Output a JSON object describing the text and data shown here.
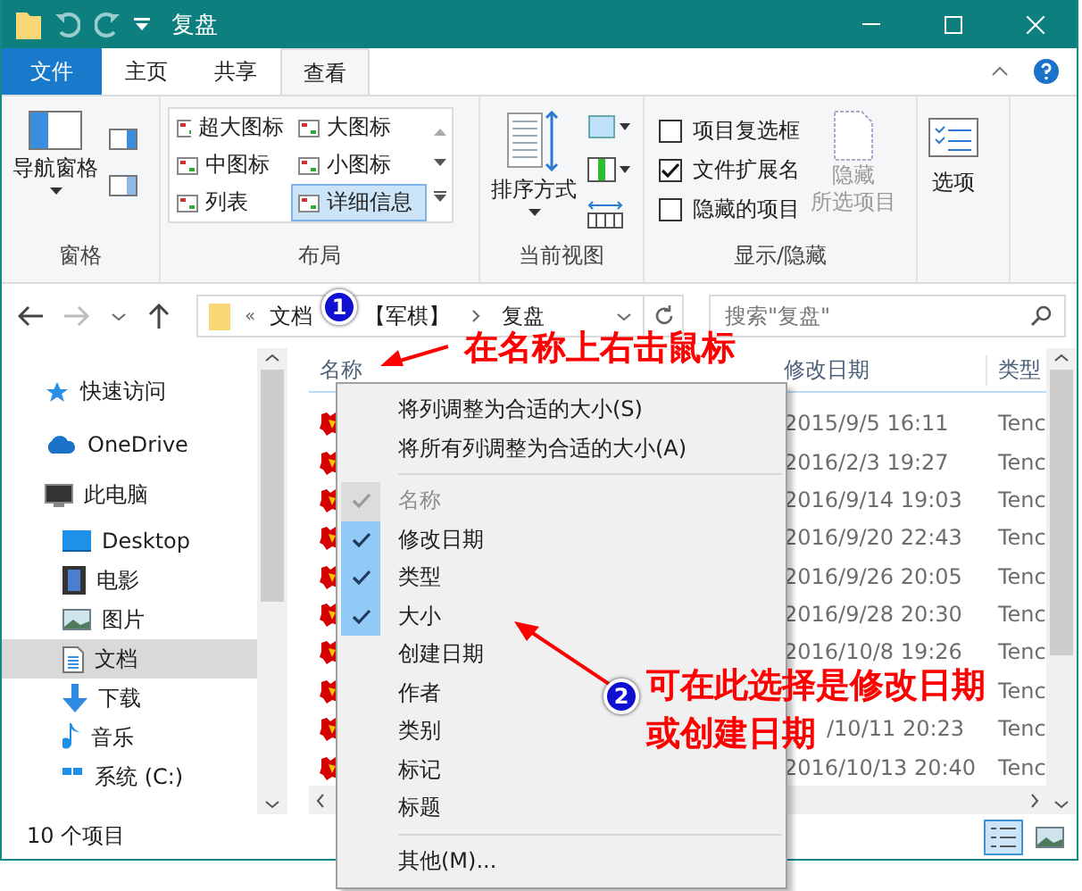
{
  "window": {
    "title": "复盘"
  },
  "ribbon": {
    "tabs": [
      {
        "label": "文件",
        "kind": "file",
        "selected": false
      },
      {
        "label": "主页",
        "kind": "tab",
        "selected": false
      },
      {
        "label": "共享",
        "kind": "tab",
        "selected": false
      },
      {
        "label": "查看",
        "kind": "tab",
        "selected": true
      }
    ],
    "pane_group": {
      "label": "窗格",
      "nav_pane": "导航窗格"
    },
    "layout_group": {
      "label": "布局",
      "options": [
        {
          "label": "超大图标",
          "selected": false
        },
        {
          "label": "大图标",
          "selected": false
        },
        {
          "label": "中图标",
          "selected": false
        },
        {
          "label": "小图标",
          "selected": false
        },
        {
          "label": "列表",
          "selected": false
        },
        {
          "label": "详细信息",
          "selected": true
        }
      ]
    },
    "view_group": {
      "label": "当前视图",
      "sort": "排序方式"
    },
    "show_group": {
      "label": "显示/隐藏",
      "checkboxes": [
        {
          "label": "项目复选框",
          "checked": false
        },
        {
          "label": "文件扩展名",
          "checked": true
        },
        {
          "label": "隐藏的项目",
          "checked": false
        }
      ],
      "hide_button": {
        "lines": [
          "隐藏",
          "所选项目"
        ],
        "disabled": true
      }
    },
    "options": "选项"
  },
  "address": {
    "overflow": "«",
    "crumbs": [
      "文档",
      "【军棋】",
      "复盘"
    ],
    "search_placeholder": "搜索\"复盘\""
  },
  "sidebar": {
    "items": [
      {
        "label": "快速访问",
        "kind": "star",
        "selected": false
      },
      {
        "label": "OneDrive",
        "kind": "cloud",
        "selected": false
      },
      {
        "label": "此电脑",
        "kind": "pc",
        "selected": false,
        "children": [
          {
            "label": "Desktop",
            "kind": "desktop",
            "selected": false
          },
          {
            "label": "电影",
            "kind": "film",
            "selected": false
          },
          {
            "label": "图片",
            "kind": "picture",
            "selected": false
          },
          {
            "label": "文档",
            "kind": "doc",
            "selected": true
          },
          {
            "label": "下载",
            "kind": "download",
            "selected": false
          },
          {
            "label": "音乐",
            "kind": "music",
            "selected": false
          },
          {
            "label": "系统 (C:)",
            "kind": "drive",
            "selected": false
          }
        ]
      }
    ]
  },
  "table": {
    "columns": [
      "名称",
      "修改日期",
      "类型"
    ],
    "rows": [
      {
        "kind": "full",
        "date": "2015/9/5 16:11",
        "type": "Tenc"
      },
      {
        "kind": "full",
        "date": "2016/2/3 19:27",
        "type": "Tenc"
      },
      {
        "kind": "full",
        "date": "2016/9/14 19:03",
        "type": "Tenc"
      },
      {
        "kind": "full",
        "date": "2016/9/20 22:43",
        "type": "Tenc"
      },
      {
        "kind": "full",
        "date": "2016/9/26 20:05",
        "type": "Tenc"
      },
      {
        "kind": "full",
        "date": "2016/9/28 20:30",
        "type": "Tenc"
      },
      {
        "kind": "full",
        "date": "2016/10/8 19:26",
        "type": "Tenc"
      },
      {
        "kind": "full",
        "type": "Tenc"
      },
      {
        "kind": "partial",
        "date": "/10/11 20:23",
        "type": "Tenc"
      },
      {
        "kind": "full",
        "date": "2016/10/13 20:40",
        "type": "Tenc"
      }
    ]
  },
  "status_bar": {
    "count": "10 个项目"
  },
  "context_menu": {
    "commands": [
      "将列调整为合适的大小(S)",
      "将所有列调整为合适的大小(A)"
    ],
    "columns": [
      {
        "label": "名称",
        "checked": true,
        "disabled": true
      },
      {
        "label": "修改日期",
        "checked": true,
        "disabled": false
      },
      {
        "label": "类型",
        "checked": true,
        "disabled": false
      },
      {
        "label": "大小",
        "checked": true,
        "disabled": false
      },
      {
        "label": "创建日期",
        "checked": false,
        "disabled": false
      },
      {
        "label": "作者",
        "checked": false,
        "disabled": false
      },
      {
        "label": "类别",
        "checked": false,
        "disabled": false
      },
      {
        "label": "标记",
        "checked": false,
        "disabled": false
      },
      {
        "label": "标题",
        "checked": false,
        "disabled": false
      }
    ],
    "more": "其他(M)..."
  },
  "annotations": [
    {
      "badge": "1",
      "lines": [
        "在名称上右击鼠标"
      ]
    },
    {
      "badge": "2",
      "lines": [
        "可在此选择是修改日期",
        "或创建日期"
      ]
    }
  ]
}
